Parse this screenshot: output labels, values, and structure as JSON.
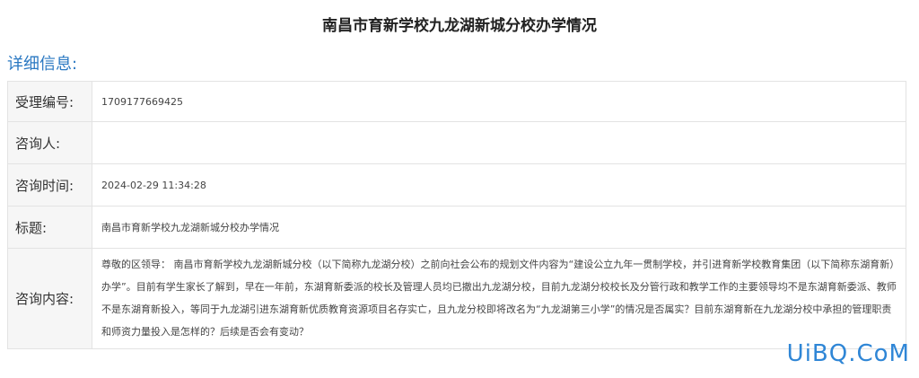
{
  "page": {
    "title": "南昌市育新学校九龙湖新城分校办学情况",
    "section_title": "详细信息:"
  },
  "details": [
    {
      "label": "受理编号:",
      "value": "1709177669425"
    },
    {
      "label": "咨询人:",
      "value": ""
    },
    {
      "label": "咨询时间:",
      "value": "2024-02-29 11:34:28"
    },
    {
      "label": "标题:",
      "value": "南昌市育新学校九龙湖新城分校办学情况"
    },
    {
      "label": "咨询内容:",
      "value": "尊敬的区领导：  南昌市育新学校九龙湖新城分校（以下简称九龙湖分校）之前向社会公布的规划文件内容为“建设公立九年一贯制学校，并引进育新学校教育集团（以下简称东湖育新）办学”。目前有学生家长了解到，早在一年前，东湖育新委派的校长及管理人员均已撤出九龙湖分校，目前九龙湖分校校长及分管行政和教学工作的主要领导均不是东湖育新委派、教师不是东湖育新投入，等同于九龙湖引进东湖育新优质教育资源项目名存实亡，且九龙分校即将改名为“九龙湖第三小学”的情况是否属实？目前东湖育新在九龙湖分校中承担的管理职责和师资力量投入是怎样的？后续是否会有变动？"
    }
  ],
  "watermark": "UiBQ.CoM"
}
